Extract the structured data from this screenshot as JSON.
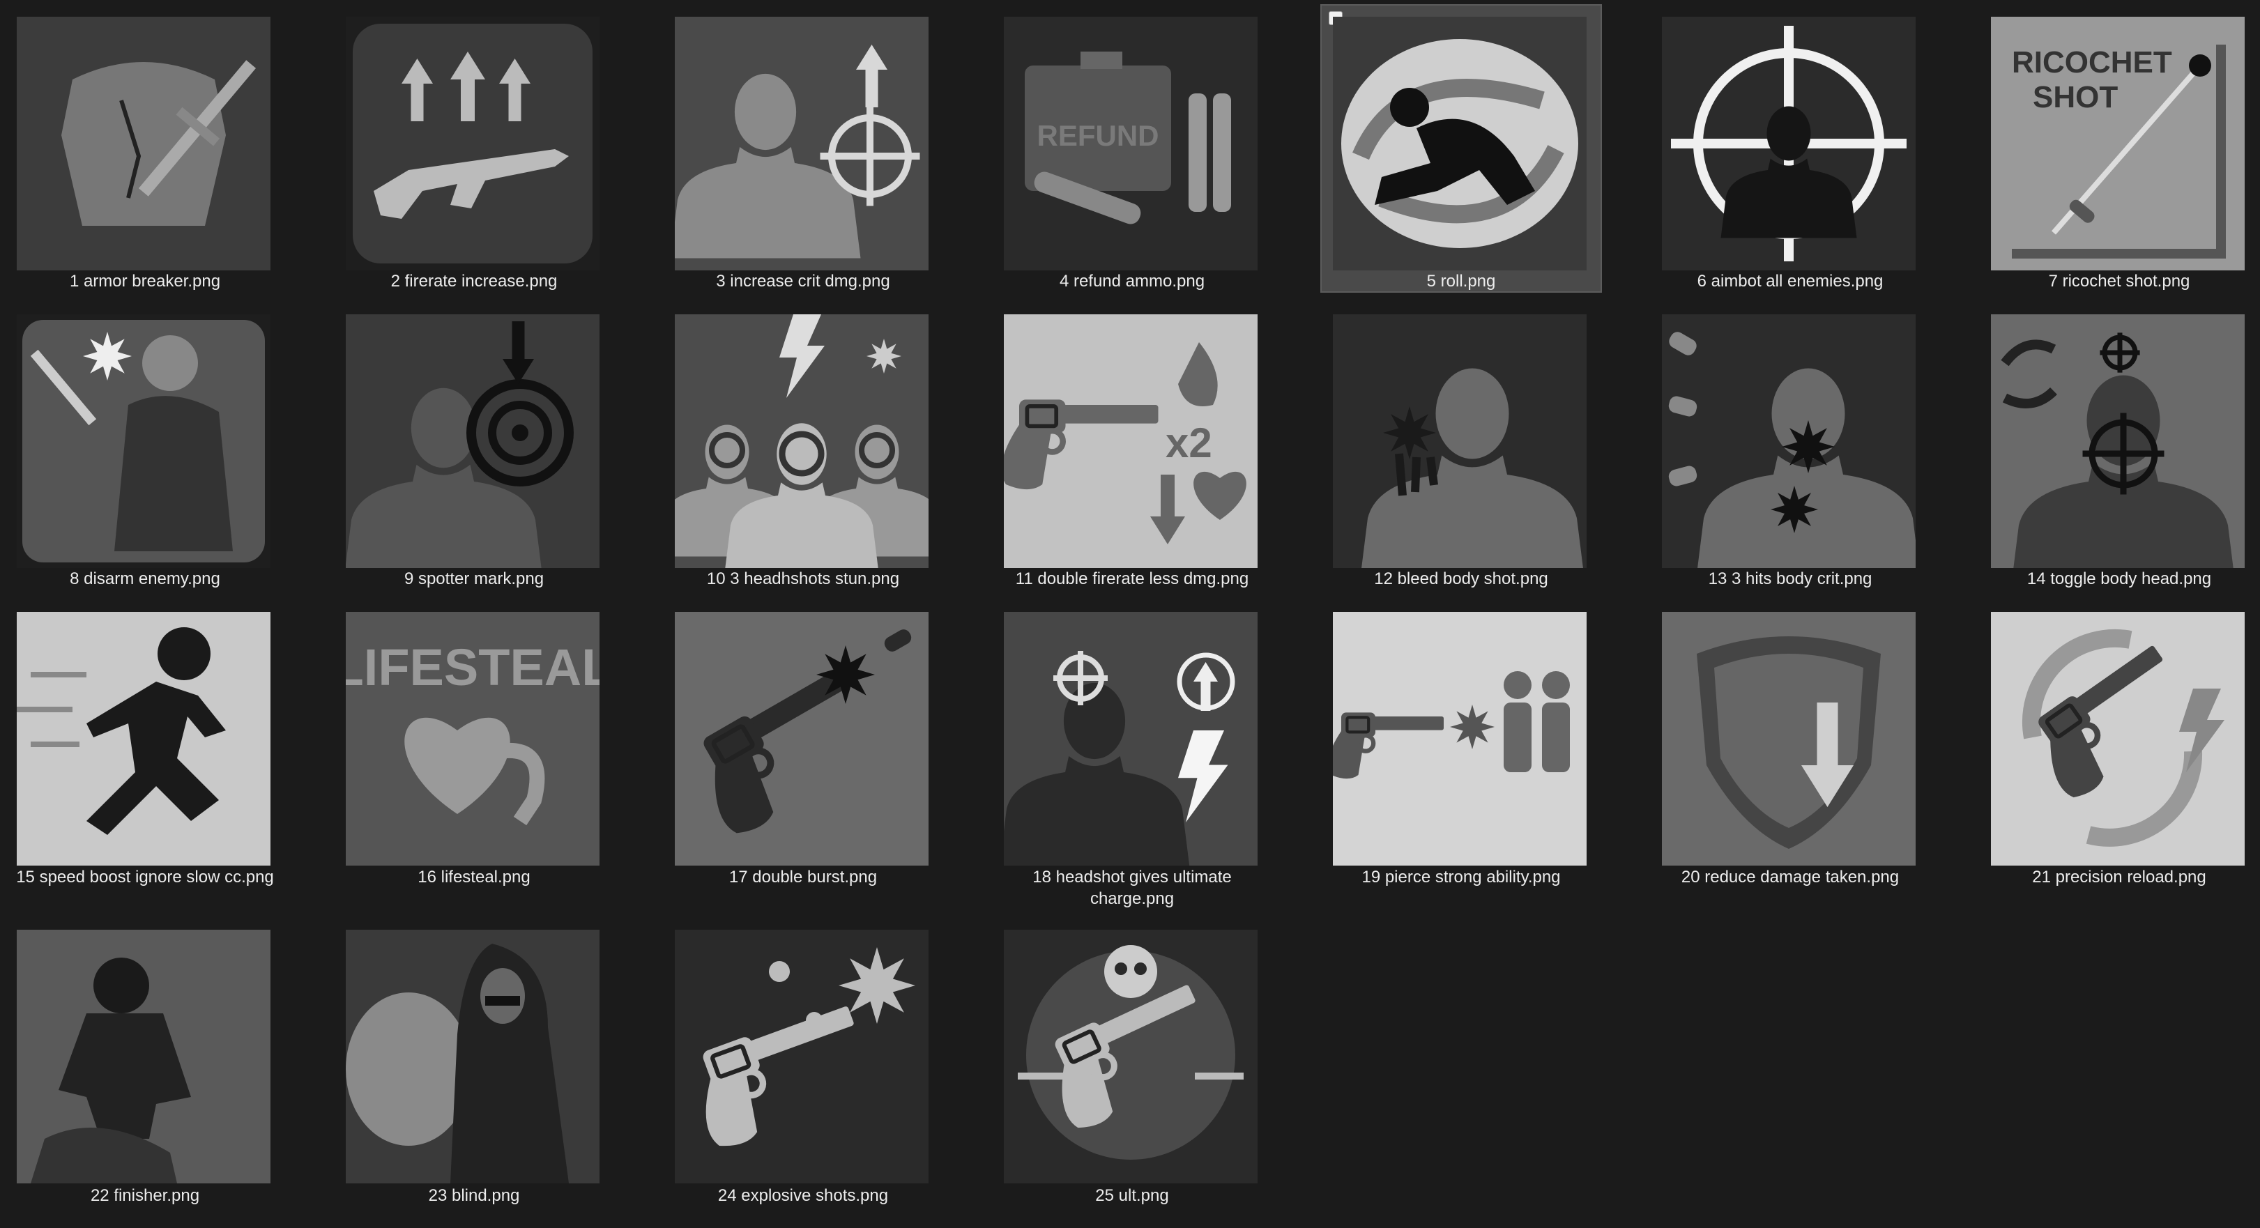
{
  "files": [
    {
      "label": "1 armor breaker.png",
      "icon": "armor-breaker-icon"
    },
    {
      "label": "2 firerate increase.png",
      "icon": "firerate-increase-icon"
    },
    {
      "label": "3 increase crit dmg.png",
      "icon": "increase-crit-dmg-icon"
    },
    {
      "label": "4 refund ammo.png",
      "icon": "refund-ammo-icon",
      "image_text": "REFUND"
    },
    {
      "label": "5 roll.png",
      "icon": "roll-icon",
      "selected": true
    },
    {
      "label": "6 aimbot all enemies.png",
      "icon": "aimbot-icon"
    },
    {
      "label": "7 ricochet shot.png",
      "icon": "ricochet-shot-icon",
      "image_text": [
        "RICOCHET",
        "SHOT"
      ]
    },
    {
      "label": "8 disarm enemy.png",
      "icon": "disarm-enemy-icon"
    },
    {
      "label": "9 spotter mark.png",
      "icon": "spotter-mark-icon"
    },
    {
      "label": "10 3 headhshots stun.png",
      "icon": "headshots-stun-icon"
    },
    {
      "label": "11 double firerate less dmg.png",
      "icon": "double-firerate-icon",
      "image_text": "x2"
    },
    {
      "label": "12 bleed body shot.png",
      "icon": "bleed-body-shot-icon"
    },
    {
      "label": "13 3 hits body crit.png",
      "icon": "body-crit-icon"
    },
    {
      "label": "14 toggle body head.png",
      "icon": "toggle-body-head-icon"
    },
    {
      "label": "15 speed boost ignore slow cc.png",
      "icon": "speed-boost-icon"
    },
    {
      "label": "16 lifesteal.png",
      "icon": "lifesteal-icon",
      "image_text": "LIFESTEAL"
    },
    {
      "label": "17 double burst.png",
      "icon": "double-burst-icon"
    },
    {
      "label": "18 headshot gives ultimate charge.png",
      "icon": "ultimate-charge-icon"
    },
    {
      "label": "19 pierce strong ability.png",
      "icon": "pierce-icon"
    },
    {
      "label": "20 reduce damage taken.png",
      "icon": "reduce-damage-icon"
    },
    {
      "label": "21 precision reload.png",
      "icon": "precision-reload-icon"
    },
    {
      "label": "22 finisher.png",
      "icon": "finisher-icon"
    },
    {
      "label": "23 blind.png",
      "icon": "blind-icon"
    },
    {
      "label": "24 explosive shots.png",
      "icon": "explosive-shots-icon"
    },
    {
      "label": "25 ult.png",
      "icon": "ult-icon"
    }
  ]
}
